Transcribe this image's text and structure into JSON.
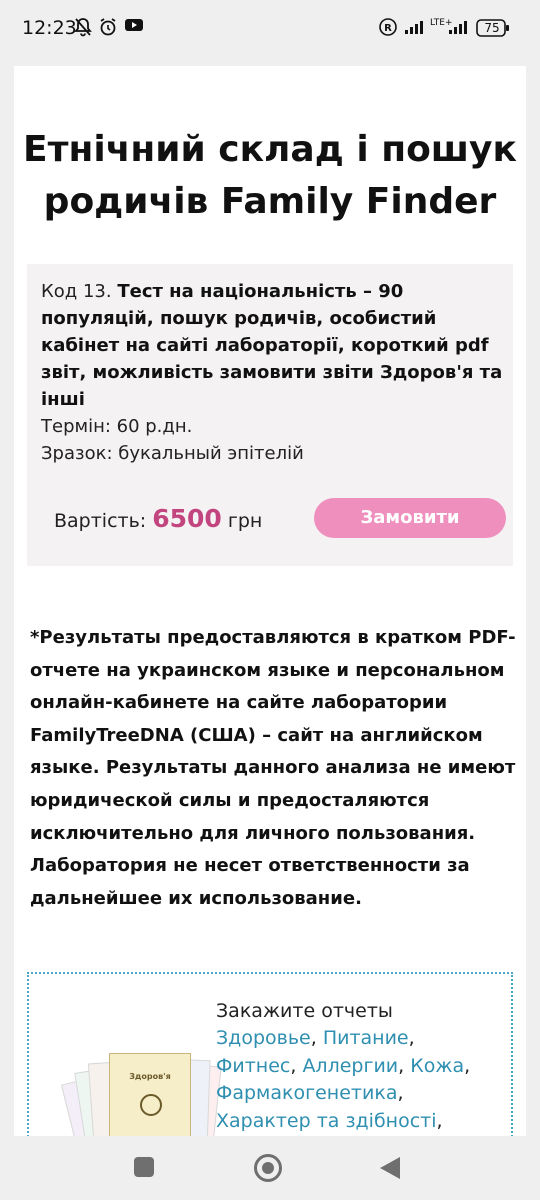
{
  "status_bar": {
    "time": "12:23",
    "icons_left": [
      "bell-off-icon",
      "alarm-icon",
      "youtube-icon"
    ],
    "network": "LTE+",
    "battery": "75"
  },
  "page": {
    "title_line1": "Етнічний склад і пошук",
    "title_line2": "родичів Family Finder",
    "product": {
      "code_prefix": "Код 13.",
      "name": "Тест на національність – 90 популяцій, пошук родичів, особистий кабінет на сайті лабораторії, короткий pdf звіт, можливість замовити звіти Здоров'я та інші",
      "term": "Термін: 60 р.дн.",
      "sample": "Зразок: букальный эпітелій",
      "price_label": "Вартість:",
      "price_amount": "6500",
      "price_currency": "грн",
      "order_button": "Замовити"
    },
    "disclaimer": "*Результаты предоставляются в кратком PDF-отчете на украинском языке и персональном онлайн-кабинете на сайте лаборатории FamilyTreeDNA (США) – сайт на английском языке. Результаты данного анализа не имеют юридической силы и предосталяются исключительно для личного пользования. Лаборатория не несет ответственности за дальнейшее их использование.",
    "promo": {
      "heading": "Закажите отчеты",
      "links": [
        "Здоровье",
        "Питание",
        "Фитнес",
        "Аллергии",
        "Кожа",
        "Фармакогенетика",
        "Характер та здібності"
      ],
      "booklet_title": "Здоров'я"
    }
  },
  "colors": {
    "accent_pink": "#c2457f",
    "button_pink": "#ef8fbd",
    "link_blue": "#2f8fb0"
  }
}
